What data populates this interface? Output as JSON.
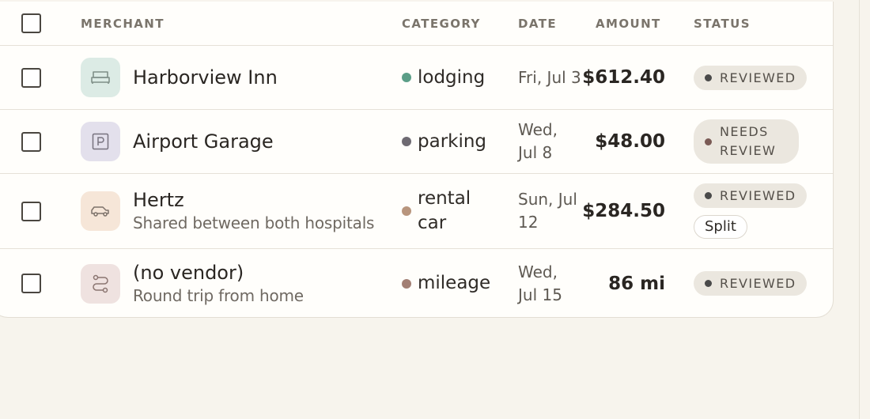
{
  "table": {
    "headers": {
      "merchant": "MERCHANT",
      "category": "CATEGORY",
      "date": "DATE",
      "amount": "AMOUNT",
      "status": "STATUS"
    },
    "rows": [
      {
        "merchant": "Harborview Inn",
        "note": "",
        "icon": "bed-icon",
        "category": "lodging",
        "category_color": "#5b9e87",
        "date": "Fri, Jul 3",
        "amount": "$612.40",
        "status": "REVIEWED",
        "split": ""
      },
      {
        "merchant": "Airport Garage",
        "note": "",
        "icon": "parking-icon",
        "category": "parking",
        "category_color": "#6e6a72",
        "date": "Wed, Jul 8",
        "amount": "$48.00",
        "status": "NEEDS REVIEW",
        "split": ""
      },
      {
        "merchant": "Hertz",
        "note": "Shared between both hospitals",
        "icon": "car-icon",
        "category": "rental car",
        "category_color": "#b8957d",
        "date": "Sun, Jul 12",
        "amount": "$284.50",
        "status": "REVIEWED",
        "split": "Split"
      },
      {
        "merchant": "(no vendor)",
        "note": "Round trip from home",
        "icon": "route-icon",
        "category": "mileage",
        "category_color": "#a27f74",
        "date": "Wed, Jul 15",
        "amount": "86 mi",
        "status": "REVIEWED",
        "split": ""
      }
    ]
  }
}
